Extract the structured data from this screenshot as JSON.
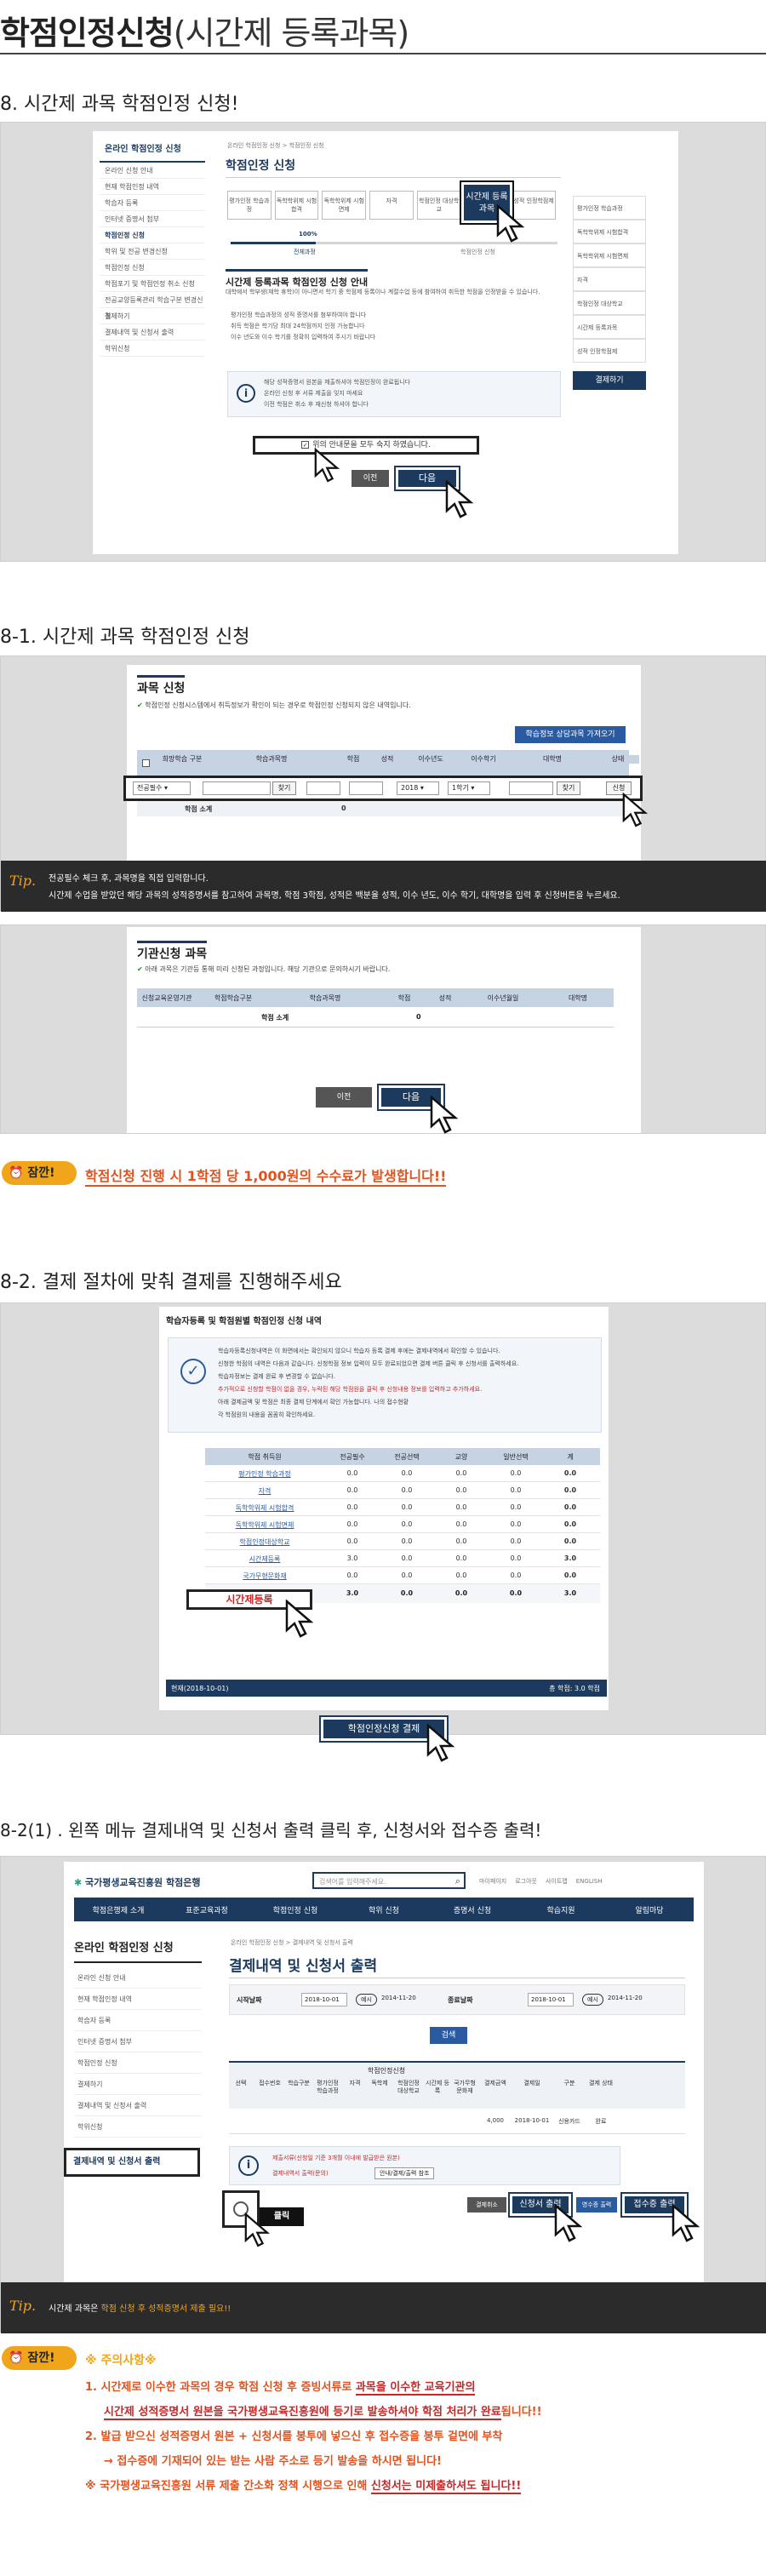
{
  "page": {
    "title_main": "학점인정신청",
    "title_sub": "(시간제 등록과목)"
  },
  "s8": {
    "heading": "8. 시간제 과목 학점인정 신청!",
    "sidebar_title": "온라인 학점인정 신청",
    "sidebar_items": [
      "온라인 신청 안내",
      "현재 학점인정 내역",
      "학습자 등록",
      "인터넷 증명서 첨부",
      "학점인정 신청",
      "학위 및 전공 변경신청",
      "학점인정 신청",
      "학점포기 및 학점인정 취소 신청",
      "전공교양등록관리 학습구분 변경신청",
      "결제하기",
      "결제내역 및 신청서 출력",
      "학위신청"
    ],
    "crumb": "온라인 학점인정 신청 > 학점인정 신청",
    "main_title": "학점인정 신청",
    "steps": [
      "평가인정 학습과정",
      "독학학위제 시험합격",
      "독학학위제 시험면제",
      "자격",
      "학점인정 대상학교",
      "시간제 등록과목",
      "성적 인정학점제"
    ],
    "progress_pct": "100%",
    "progress_left": "전체과정",
    "progress_right": "학점인정 신청",
    "guide_title": "시간제 등록과목 학점인정 신청 안내",
    "guide_text": "대학에서 학부생(재학 휴학)이 아니면서 학기 중 학점제 등록이나 계절수업 등에 참여하여 취득한 학점을 인정받을 수 있습니다.",
    "bullets": [
      "평가인정 학습과정의 성적 증명서를 첨부하여야 합니다",
      "취득 학점은 학기당 최대 24학점까지 인정 가능합니다",
      "이수 년도와 이수 학기를 정확히 입력하여 주시기 바랍니다"
    ],
    "note_lines": [
      "해당 성적증명서 원본을 제출하셔야 학점인정이 완료됩니다",
      "온라인 신청 후 서류 제출을 잊지 마세요",
      "이전 학점은 취소 후 재신청 하셔야 합니다"
    ],
    "agree": "위의 안내문을 모두 숙지 하였습니다.",
    "prev": "이전",
    "next": "다음",
    "right_menu": [
      "평가인정 학습과정",
      "독학학위제 시험합격",
      "독학학위제 시험면제",
      "자격",
      "학점인정 대상학교",
      "시간제 등록과목",
      "성적 인정학점제"
    ],
    "right_btn": "결제하기"
  },
  "s81": {
    "heading": "8-1. 시간제 과목 학점인정 신청",
    "card1_title": "과목 신청",
    "card1_note": "학점인정 신청시스템에서 취득정보가 확인이 되는 경우로 학점인정 신청되지 않은 내역입니다.",
    "import_btn": "학습정보 상담과목 가져오기",
    "cols": [
      "희망학습 구분",
      "학습과목명",
      "학점",
      "성적",
      "이수년도",
      "이수학기",
      "대학명",
      "상태"
    ],
    "row_select": "전공필수",
    "row_find": "찾기",
    "row_year": "2018",
    "row_term": "1학기",
    "row_find2": "찾기",
    "row_apply": "신청",
    "subtotal": "학점 소계",
    "subtotal_val": "0",
    "tip": "Tip.",
    "tip_l1": "전공필수 체크 후, 과목명을 직접 입력합니다.",
    "tip_l2": "시간제 수업을 받았던 해당 과목의 성적증명서를 참고하여 과목명, 학점 3학점, 성적은 백분율 성적, 이수 년도, 이수 학기, 대학명을 입력 후 신청버튼을 누르세요.",
    "card2_title": "기관신청 과목",
    "card2_note": "아래 과목은 기관등 통해 미리 신청된 과정입니다. 해당 기관으로 문의하시기 바랍니다.",
    "cols2": [
      "신청교육운영기관",
      "학점학습구분",
      "학습과목명",
      "학점",
      "성적",
      "이수년월일",
      "대학명"
    ],
    "subtotal2": "학점 소계",
    "subtotal2_val": "0",
    "prev": "이전",
    "next": "다음",
    "badge": "잠깐!",
    "warn": "학점신청 진행 시 1학점 당 1,000원의 수수료가 발생합니다!!"
  },
  "s82": {
    "heading": "8-2. 결제 절차에 맞춰 결제를 진행해주세요",
    "card_title": "학습자등록 및 학점원별 학점인정 신청 내역",
    "notes": [
      "학습자등록신청내역은 이 화면에서는 확인되지 않으니 학습자 등록 결제 후에는 결제내역에서 확인할 수 있습니다.",
      "신청한 학점의 내역은 다음과 같습니다. 신청학점 정보 입력이 모두 완료되었으면 결제 버튼 클릭 후 신청서를 출력하세요.",
      "학습자정보는 결제 완료 후 변경할 수 없습니다.",
      "추가적으로 신청할 학점이 없을 경우, 누락된 해당 학점원을 클릭 후 신청내용 정보를 입력하고 추가하세요.",
      "아래 결제금액 및 학점은 최종 결제 단계에서 확인 가능합니다. 나의 접수현황",
      "각 학점원의 내용을 꼼꼼히 확인하세요."
    ],
    "cols": [
      "학점 취득원",
      "전공필수",
      "전공선택",
      "교양",
      "일반선택",
      "계"
    ],
    "rows": [
      {
        "name": "평가인정 학습과정",
        "v": [
          "0.0",
          "0.0",
          "0.0",
          "0.0",
          "0.0"
        ]
      },
      {
        "name": "자격",
        "v": [
          "0.0",
          "0.0",
          "0.0",
          "0.0",
          "0.0"
        ]
      },
      {
        "name": "독학학위제 시험합격",
        "v": [
          "0.0",
          "0.0",
          "0.0",
          "0.0",
          "0.0"
        ]
      },
      {
        "name": "독학학위제 시험면제",
        "v": [
          "0.0",
          "0.0",
          "0.0",
          "0.0",
          "0.0"
        ]
      },
      {
        "name": "학점인정대상학교",
        "v": [
          "0.0",
          "0.0",
          "0.0",
          "0.0",
          "0.0"
        ]
      },
      {
        "name": "시간제등록",
        "v": [
          "3.0",
          "0.0",
          "0.0",
          "0.0",
          "3.0"
        ]
      },
      {
        "name": "국가무형문화재",
        "v": [
          "0.0",
          "0.0",
          "0.0",
          "0.0",
          "0.0"
        ]
      }
    ],
    "total_label": "총계",
    "total_vals": [
      "3.0",
      "0.0",
      "0.0",
      "0.0",
      "3.0"
    ],
    "bar_left": "현재(2018-10-01)",
    "bar_right": "총 학점: 3.0 학점",
    "pay_btn": "학점인정신청 결제"
  },
  "s821": {
    "heading": "8-2(1) . 왼쪽 메뉴 결제내역 및 신청서 출력 클릭 후, 신청서와 접수증 출력!",
    "logo": "국가평생교육진흥원 학점은행",
    "search_ph": "검색어를 입력해주세요.",
    "top_links": [
      "마이페이지",
      "로그아웃",
      "사이트맵",
      "ENGLISH"
    ],
    "gnb": [
      "학점은행제 소개",
      "표준교육과정",
      "학점인정 신청",
      "학위 신청",
      "증명서 신청",
      "학습지원",
      "알림마당"
    ],
    "side_title": "온라인 학점인정 신청",
    "side_items": [
      "온라인 신청 안내",
      "현재 학점인정 내역",
      "학습자 등록",
      "인터넷 증명서 첨부",
      "학점인정 신청",
      "결제하기",
      "결제내역 및 신청서 출력",
      "학위신청"
    ],
    "crumb": "온라인 학점인정 신청 > 결제내역 및 신청서 출력",
    "title": "결제내역 및 신청서 출력",
    "start_label": "시작날짜",
    "start_val": "2018-10-01",
    "ex1": "예시",
    "ex1_date": "2014-11-20",
    "end_label": "종료날짜",
    "end_val": "2018-10-01",
    "ex2": "예시",
    "ex2_date": "2014-11-20",
    "search_btn": "검색",
    "group_head": "학점인정신청",
    "cols": [
      "선택",
      "접수번호",
      "학습구분",
      "평가인정 학습과정",
      "자격",
      "독학제",
      "학점인정 대상학교",
      "시간제 등록",
      "국가무형 문화재",
      "결제금액",
      "결제일",
      "구분",
      "결제 상태"
    ],
    "row": [
      "",
      "",
      "",
      "",
      "",
      "",
      "",
      "",
      "",
      "4,000",
      "2018-10-01",
      "신용카드",
      "완료"
    ],
    "click": "클릭",
    "notice1": "제출서류(신청일 기준 3개월 이내에 발급받은 원본)",
    "notice2": "결제내역서 출력(문의)",
    "notice_btn": "안내/결제/출력 참조",
    "btn_pay": "결제취소",
    "btn_form": "신청서 출력",
    "btn_receipt_small": "영수증 출력",
    "btn_receipt": "접수증 출력",
    "tip": "Tip.",
    "tip_text_a": "시간제 과목은 ",
    "tip_text_b": "학점 신청 후 성적증명서 제출 필요!!"
  },
  "caution": {
    "badge": "잠깐!",
    "title": "※ 주의사항※",
    "l1a": "1. 시간제로 이수한 과목의 경우 학점 신청 후 증빙서류로 ",
    "l1b": "과목을 이수한 교육기관의",
    "l1c": "시간제 성적증명서 원본을 국가평생교육진흥원에 등기로 발송하셔야 학점 처리가 완료",
    "l1d": "됩니다!!",
    "l2a": "2. 발급 받으신 성적증명서 원본 + 신청서를 봉투에 넣으신 후 접수증을 봉투 겉면에 부착",
    "l2b": "→ 접수증에 기재되어 있는 받는 사람 주소로 등기 발송을 하시면 됩니다!",
    "l3a": "※ 국가평생교육진흥원 서류 제출 간소화 정책 시행으로 인해 ",
    "l3b": "신청서는 미제출하셔도 됩니다!!"
  }
}
